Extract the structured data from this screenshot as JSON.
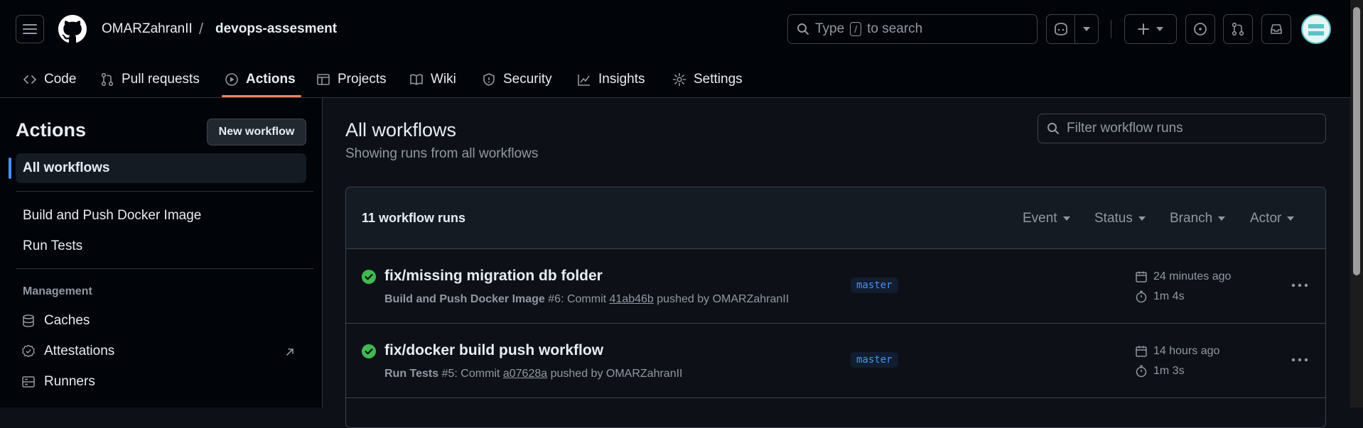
{
  "header": {
    "owner": "OMARZahranII",
    "separator": "/",
    "repo": "devops-assesment",
    "search_prefix": "Type",
    "search_key": "/",
    "search_suffix": "to search"
  },
  "nav": {
    "code": "Code",
    "pulls": "Pull requests",
    "actions": "Actions",
    "projects": "Projects",
    "wiki": "Wiki",
    "security": "Security",
    "insights": "Insights",
    "settings": "Settings"
  },
  "sidebar": {
    "title": "Actions",
    "new_workflow": "New workflow",
    "all_workflows": "All workflows",
    "workflows": [
      "Build and Push Docker Image",
      "Run Tests"
    ],
    "management_label": "Management",
    "management": [
      "Caches",
      "Attestations",
      "Runners"
    ]
  },
  "main": {
    "title": "All workflows",
    "subtitle": "Showing runs from all workflows",
    "filter_placeholder": "Filter workflow runs",
    "runs_count": "11 workflow runs",
    "filters": {
      "event": "Event",
      "status": "Status",
      "branch": "Branch",
      "actor": "Actor"
    },
    "runs": [
      {
        "title": "fix/missing migration db folder",
        "workflow": "Build and Push Docker Image",
        "run_no": "#6: Commit",
        "commit": "41ab46b",
        "pushed_by": "pushed by OMARZahranII",
        "branch": "master",
        "when": "24 minutes ago",
        "duration": "1m 4s"
      },
      {
        "title": "fix/docker build push workflow",
        "workflow": "Run Tests",
        "run_no": "#5: Commit",
        "commit": "a07628a",
        "pushed_by": "pushed by OMARZahranII",
        "branch": "master",
        "when": "14 hours ago",
        "duration": "1m 3s"
      }
    ]
  },
  "colors": {
    "accent": "#4493f8",
    "success": "#3fb950",
    "nav_underline": "#f78166"
  }
}
